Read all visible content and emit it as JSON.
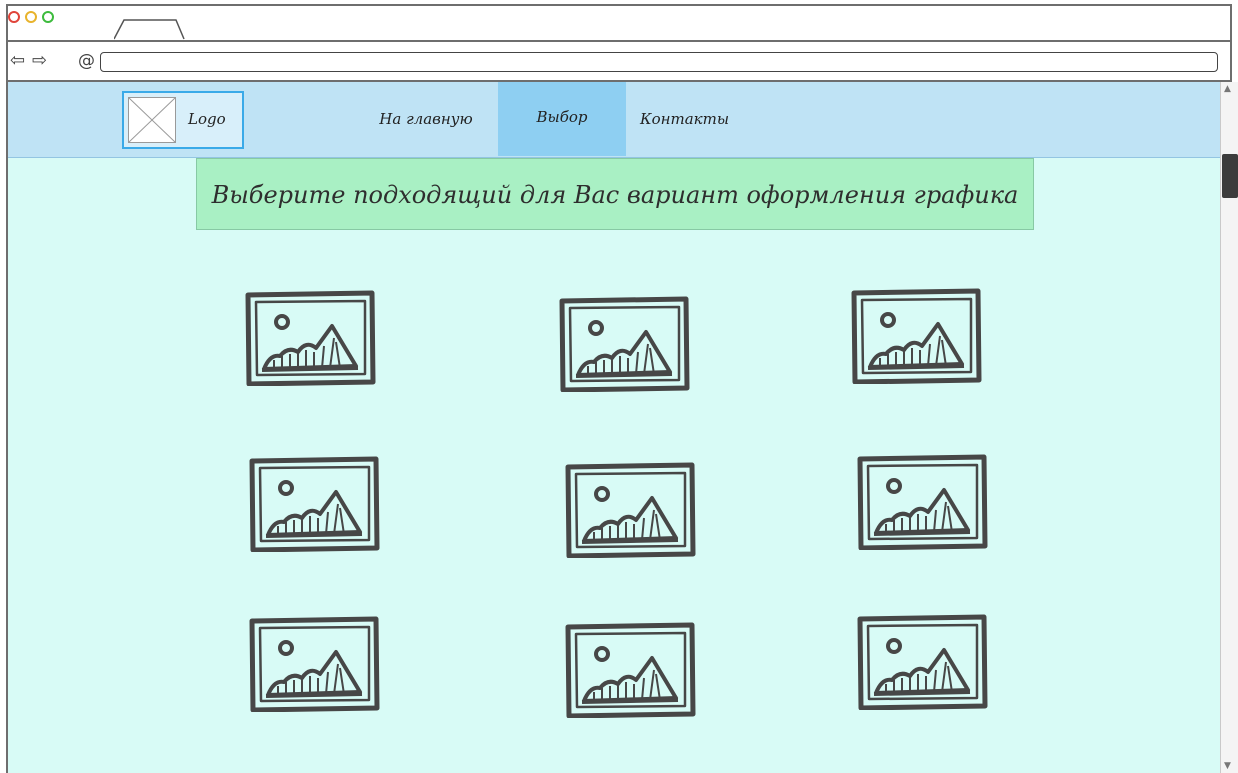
{
  "browser": {
    "tab_label": "",
    "url": ""
  },
  "header": {
    "logo_label": "Logo",
    "nav": [
      {
        "label": "На главную",
        "active": false
      },
      {
        "label": "Выбор",
        "active": true
      },
      {
        "label": "Контакты",
        "active": false
      }
    ]
  },
  "main": {
    "heading": "Выберите подходящий для Вас вариант оформления графика",
    "gallery": {
      "rows": 3,
      "columns": 3,
      "items": [
        "image-placeholder",
        "image-placeholder",
        "image-placeholder",
        "image-placeholder",
        "image-placeholder",
        "image-placeholder",
        "image-placeholder",
        "image-placeholder",
        "image-placeholder"
      ]
    }
  },
  "colors": {
    "navbar_bg": "#bfe3f5",
    "active_nav_bg": "#8ecff2",
    "page_bg": "#d8fbf6",
    "heading_bg": "#a9f0c4",
    "logo_border": "#3aaae8"
  }
}
